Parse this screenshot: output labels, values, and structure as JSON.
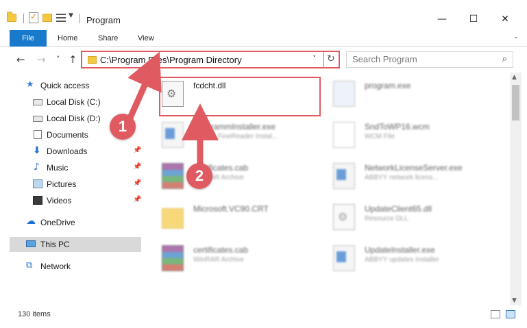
{
  "window": {
    "title": "Program",
    "minimize": "—",
    "maximize": "☐",
    "close": "✕"
  },
  "ribbon": {
    "tabs": [
      "File",
      "Home",
      "Share",
      "View"
    ],
    "expand_icon": "chevron-down-icon"
  },
  "nav": {
    "back": "←",
    "forward": "→",
    "recent": "˅",
    "up": "↑"
  },
  "address": {
    "path": "C:\\Program Files\\Program Directory",
    "dropdown": "˅",
    "refresh": "↻"
  },
  "search": {
    "placeholder": "Search Program",
    "icon": "⌕"
  },
  "sidebar": {
    "items": [
      {
        "label": "Quick access",
        "icon": "star-icon",
        "glyph": "★"
      },
      {
        "label": "Local Disk (C:)",
        "icon": "disk-icon"
      },
      {
        "label": "Local Disk (D:)",
        "icon": "disk-icon"
      },
      {
        "label": "Documents",
        "icon": "document-icon"
      },
      {
        "label": "Downloads",
        "icon": "download-icon",
        "glyph": "⬇"
      },
      {
        "label": "Music",
        "icon": "music-icon",
        "glyph": "♪"
      },
      {
        "label": "Pictures",
        "icon": "picture-icon"
      },
      {
        "label": "Videos",
        "icon": "video-icon"
      },
      {
        "label": "OneDrive",
        "icon": "cloud-icon",
        "glyph": "☁"
      },
      {
        "label": "This PC",
        "icon": "computer-icon"
      },
      {
        "label": "Network",
        "icon": "network-icon",
        "glyph": "⧉"
      }
    ],
    "pin_glyph": "📌"
  },
  "files": [
    {
      "name": "fcdcht.dll",
      "type": "",
      "icon": "dll-icon"
    },
    {
      "name": "program.exe",
      "type": "",
      "icon": "program-icon"
    },
    {
      "name": "ProgrammInstaller.exe",
      "type": "ABBYY FineReader Instal...",
      "icon": "exe-icon"
    },
    {
      "name": "SndToWP16.wcm",
      "type": "WCM File",
      "icon": "file-icon"
    },
    {
      "name": "certificates.cab",
      "type": "WinRAR Archive",
      "icon": "archive-icon"
    },
    {
      "name": "NetworkLicenseServer.exe",
      "type": "ABBYY network licens...",
      "icon": "exe-icon"
    },
    {
      "name": "Microsoft.VC90.CRT",
      "type": "",
      "icon": "folder-icon"
    },
    {
      "name": "UpdateClient65.dll",
      "type": "Resource DLL",
      "icon": "dll-icon"
    },
    {
      "name": "certificates.cab",
      "type": "WinRAR Archive",
      "icon": "archive-icon"
    },
    {
      "name": "UpdateInstaller.exe",
      "type": "ABBYY updates installer",
      "icon": "exe-icon"
    }
  ],
  "status": {
    "item_count": "130 items"
  },
  "annotations": {
    "badge1": "1",
    "badge2": "2",
    "color": "#e05b61"
  }
}
